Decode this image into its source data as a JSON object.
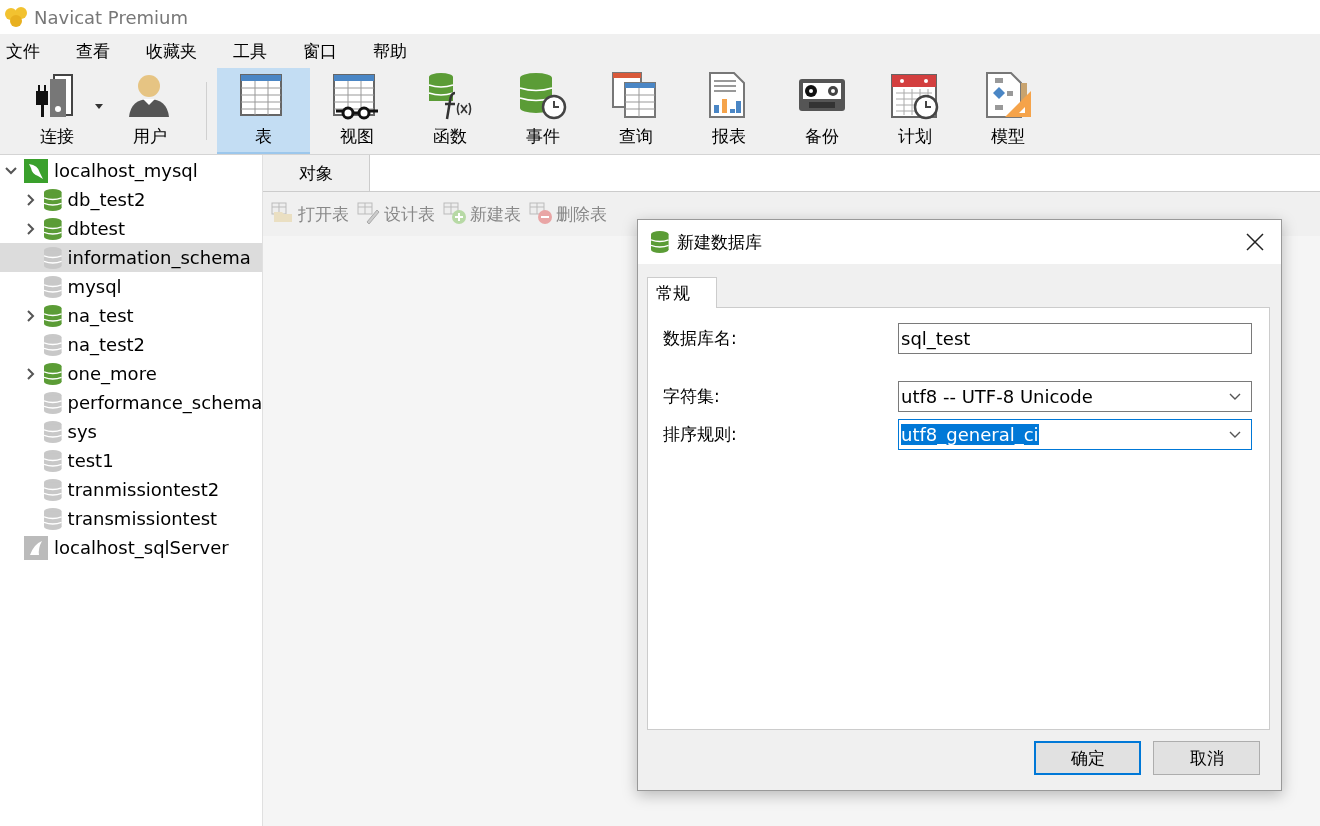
{
  "window": {
    "title": "Navicat Premium"
  },
  "menu": [
    "文件",
    "查看",
    "收藏夹",
    "工具",
    "窗口",
    "帮助"
  ],
  "toolbar": [
    {
      "label": "连接",
      "kind": "connection",
      "selected": false,
      "dropdown": true
    },
    {
      "label": "用户",
      "kind": "user",
      "selected": false
    },
    {
      "label": "表",
      "kind": "table",
      "selected": true
    },
    {
      "label": "视图",
      "kind": "view",
      "selected": false
    },
    {
      "label": "函数",
      "kind": "function",
      "selected": false
    },
    {
      "label": "事件",
      "kind": "event",
      "selected": false
    },
    {
      "label": "查询",
      "kind": "query",
      "selected": false
    },
    {
      "label": "报表",
      "kind": "report",
      "selected": false
    },
    {
      "label": "备份",
      "kind": "backup",
      "selected": false
    },
    {
      "label": "计划",
      "kind": "schedule",
      "selected": false
    },
    {
      "label": "模型",
      "kind": "model",
      "selected": false
    }
  ],
  "tree": [
    {
      "label": "localhost_mysql",
      "kind": "mysql",
      "expanded": true,
      "selected": false,
      "children": [
        {
          "label": "db_test2",
          "kind": "database",
          "open": true,
          "selected": false
        },
        {
          "label": "dbtest",
          "kind": "database",
          "open": true,
          "selected": false
        },
        {
          "label": "information_schema",
          "kind": "database",
          "open": false,
          "selected": true
        },
        {
          "label": "mysql",
          "kind": "database",
          "open": false,
          "selected": false
        },
        {
          "label": "na_test",
          "kind": "database",
          "open": true,
          "selected": false
        },
        {
          "label": "na_test2",
          "kind": "database",
          "open": false,
          "selected": false
        },
        {
          "label": "one_more",
          "kind": "database",
          "open": true,
          "selected": false
        },
        {
          "label": "performance_schema",
          "kind": "database",
          "open": false,
          "selected": false
        },
        {
          "label": "sys",
          "kind": "database",
          "open": false,
          "selected": false
        },
        {
          "label": "test1",
          "kind": "database",
          "open": false,
          "selected": false
        },
        {
          "label": "tranmissiontest2",
          "kind": "database",
          "open": false,
          "selected": false
        },
        {
          "label": "transmissiontest",
          "kind": "database",
          "open": false,
          "selected": false
        }
      ]
    },
    {
      "label": "localhost_sqlServer",
      "kind": "sqlserver",
      "expanded": false,
      "selected": false
    }
  ],
  "tabs": [
    {
      "label": "对象",
      "selected": true
    }
  ],
  "object_toolbar": [
    {
      "label": "打开表",
      "kind": "open",
      "disabled": true
    },
    {
      "label": "设计表",
      "kind": "design",
      "disabled": true
    },
    {
      "label": "新建表",
      "kind": "new",
      "disabled": true
    },
    {
      "label": "删除表",
      "kind": "delete",
      "disabled": true
    }
  ],
  "dialog": {
    "title": "新建数据库",
    "tabs": [
      {
        "label": "常规",
        "selected": true
      }
    ],
    "fields": [
      {
        "label": "数据库名:",
        "kind": "text",
        "value": "sql_test",
        "focused": false,
        "highlighted": false
      },
      {
        "label": "字符集:",
        "kind": "select",
        "value": "utf8 -- UTF-8 Unicode",
        "focused": false,
        "highlighted": false
      },
      {
        "label": "排序规则:",
        "kind": "select",
        "value": "utf8_general_ci",
        "focused": true,
        "highlighted": true
      }
    ],
    "buttons": [
      {
        "label": "确定",
        "default": true
      },
      {
        "label": "取消",
        "default": false
      }
    ]
  }
}
